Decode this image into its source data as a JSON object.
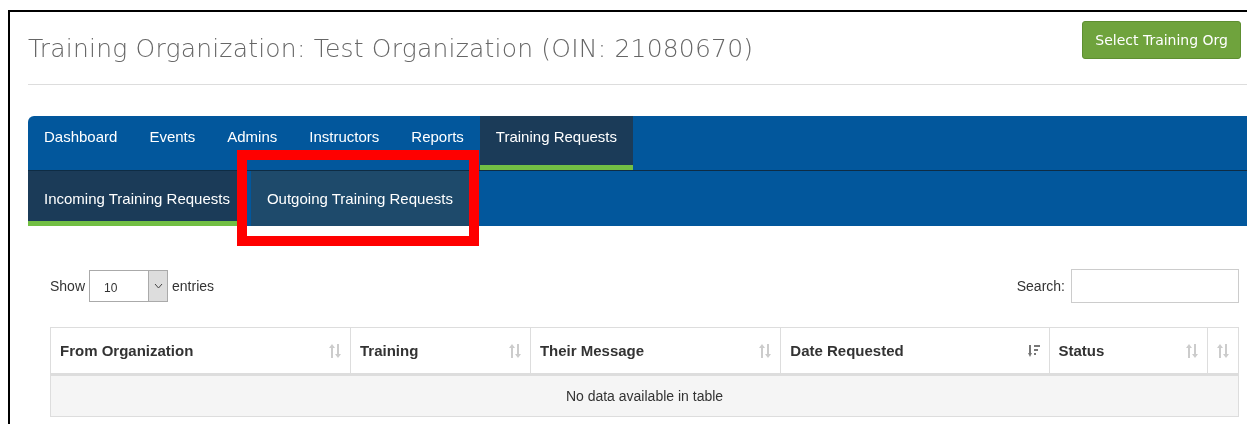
{
  "header": {
    "title": "Training Organization: Test Organization (OIN: 21080670)",
    "button": "Select Training Org"
  },
  "nav": {
    "tabs": [
      {
        "label": "Dashboard",
        "selected": false
      },
      {
        "label": "Events",
        "selected": false
      },
      {
        "label": "Admins",
        "selected": false
      },
      {
        "label": "Instructors",
        "selected": false
      },
      {
        "label": "Reports",
        "selected": false
      },
      {
        "label": "Training Requests",
        "selected": true
      }
    ],
    "subtabs": [
      {
        "label": "Incoming Training Requests",
        "selected": true,
        "hovered": false
      },
      {
        "label": "Outgoing Training Requests",
        "selected": false,
        "hovered": true
      }
    ]
  },
  "highlight": {
    "kind": "frame",
    "color": "#ff0000"
  },
  "table_controls": {
    "show_label": "Show",
    "page_size": "10",
    "entries_label": "entries",
    "search_label": "Search:"
  },
  "table": {
    "columns": [
      {
        "label": "From Organization",
        "sorted": false
      },
      {
        "label": "Training",
        "sorted": false
      },
      {
        "label": "Their Message",
        "sorted": false
      },
      {
        "label": "Date Requested",
        "sorted": true
      },
      {
        "label": "Status",
        "sorted": false
      },
      {
        "sorted": false
      }
    ],
    "empty_message": "No data available in table"
  }
}
